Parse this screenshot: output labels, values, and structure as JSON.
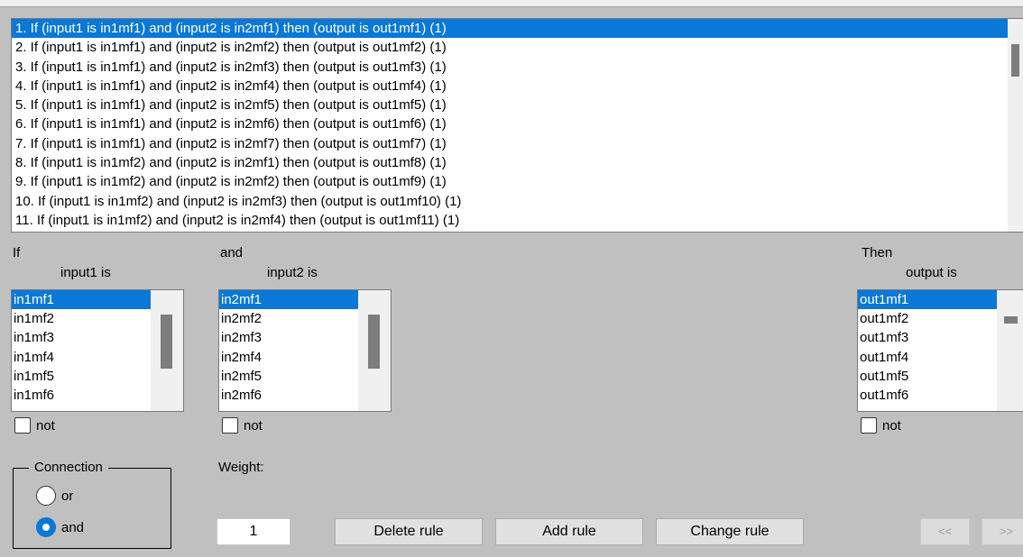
{
  "rules": {
    "items": [
      "1. If (input1 is in1mf1) and (input2 is in2mf1) then (output is out1mf1) (1)",
      "2. If (input1 is in1mf1) and (input2 is in2mf2) then (output is out1mf2) (1)",
      "3. If (input1 is in1mf1) and (input2 is in2mf3) then (output is out1mf3) (1)",
      "4. If (input1 is in1mf1) and (input2 is in2mf4) then (output is out1mf4) (1)",
      "5. If (input1 is in1mf1) and (input2 is in2mf5) then (output is out1mf5) (1)",
      "6. If (input1 is in1mf1) and (input2 is in2mf6) then (output is out1mf6) (1)",
      "7. If (input1 is in1mf1) and (input2 is in2mf7) then (output is out1mf7) (1)",
      "8. If (input1 is in1mf2) and (input2 is in2mf1) then (output is out1mf8) (1)",
      "9. If (input1 is in1mf2) and (input2 is in2mf2) then (output is out1mf9) (1)",
      "10. If (input1 is in1mf2) and (input2 is in2mf3) then (output is out1mf10) (1)",
      "11. If (input1 is in1mf2) and (input2 is in2mf4) then (output is out1mf11) (1)"
    ],
    "selected_index": 0
  },
  "if_section": {
    "heading": "If",
    "var_label": "input1 is",
    "items": [
      "in1mf1",
      "in1mf2",
      "in1mf3",
      "in1mf4",
      "in1mf5",
      "in1mf6"
    ],
    "not_label": "not"
  },
  "and_section": {
    "heading": "and",
    "var_label": "input2 is",
    "items": [
      "in2mf1",
      "in2mf2",
      "in2mf3",
      "in2mf4",
      "in2mf5",
      "in2mf6"
    ],
    "not_label": "not"
  },
  "then_section": {
    "heading": "Then",
    "var_label": "output is",
    "items": [
      "out1mf1",
      "out1mf2",
      "out1mf3",
      "out1mf4",
      "out1mf5",
      "out1mf6"
    ],
    "not_label": "not"
  },
  "connection": {
    "legend": "Connection",
    "or_label": "or",
    "and_label": "and",
    "selected": "and"
  },
  "weight": {
    "label": "Weight:",
    "value": "1"
  },
  "buttons": {
    "delete": "Delete rule",
    "add": "Add rule",
    "change": "Change rule",
    "prev": "<<",
    "next": ">>"
  },
  "colors": {
    "selection": "#0a78d7",
    "panel_bg": "#c0c0c0"
  }
}
